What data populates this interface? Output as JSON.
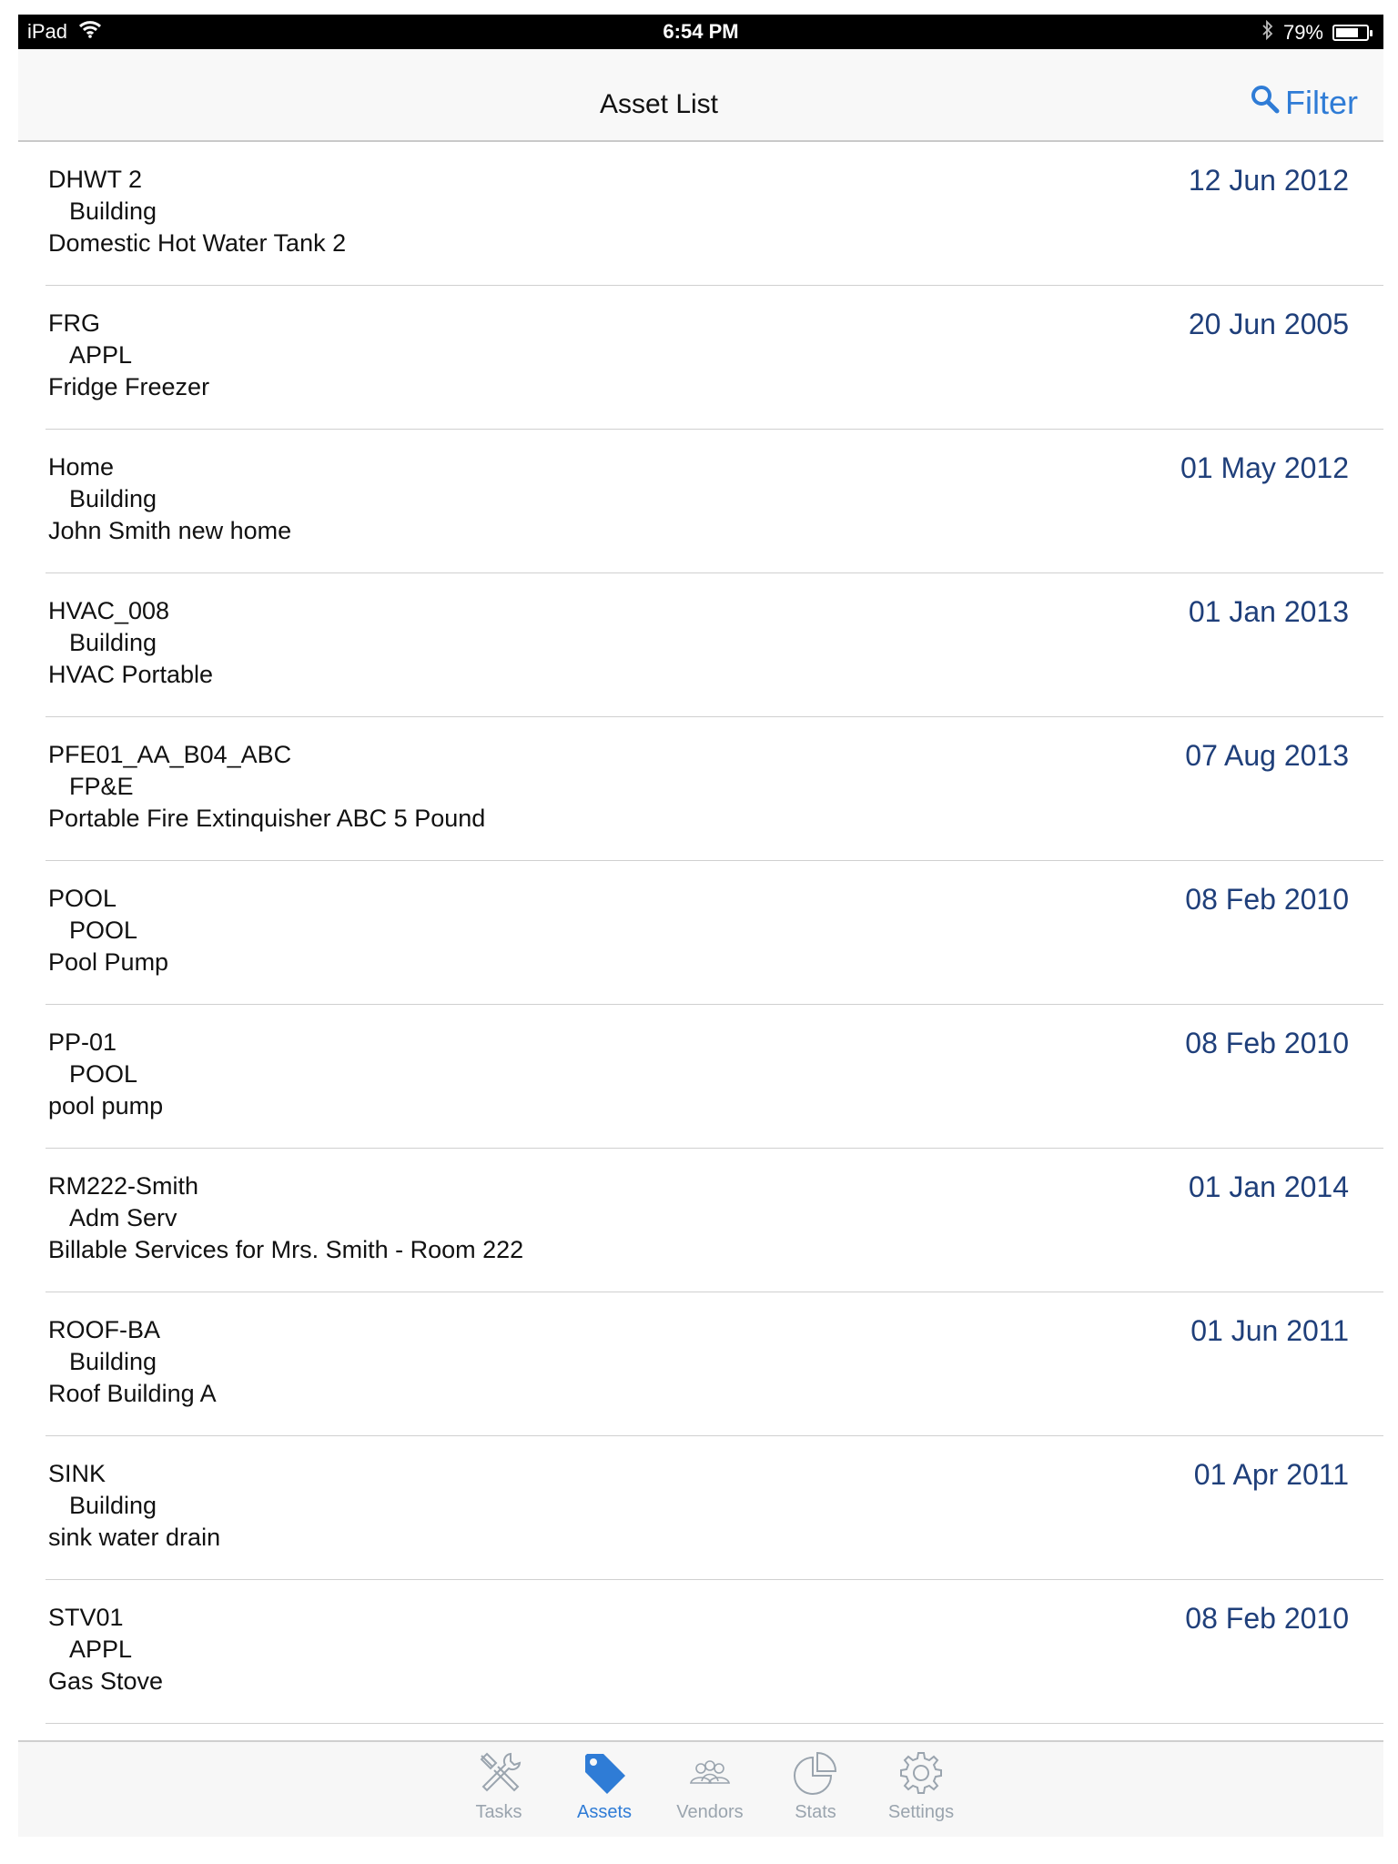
{
  "status_bar": {
    "device": "iPad",
    "time": "6:54 PM",
    "battery": "79%",
    "battery_level": 0.79
  },
  "nav": {
    "title": "Asset List",
    "filter_label": "Filter"
  },
  "assets": [
    {
      "code": "DHWT 2",
      "category": "Building",
      "description": "Domestic Hot Water Tank 2",
      "date": "12 Jun 2012"
    },
    {
      "code": "FRG",
      "category": "APPL",
      "description": "Fridge Freezer",
      "date": "20 Jun 2005"
    },
    {
      "code": "Home",
      "category": "Building",
      "description": "John Smith new home",
      "date": "01 May 2012"
    },
    {
      "code": "HVAC_008",
      "category": "Building",
      "description": "HVAC Portable",
      "date": "01 Jan 2013"
    },
    {
      "code": "PFE01_AA_B04_ABC",
      "category": "FP&E",
      "description": "Portable Fire Extinquisher ABC 5 Pound",
      "date": "07 Aug 2013"
    },
    {
      "code": "POOL",
      "category": "POOL",
      "description": "Pool Pump",
      "date": "08 Feb 2010"
    },
    {
      "code": "PP-01",
      "category": "POOL",
      "description": "pool pump",
      "date": "08 Feb 2010"
    },
    {
      "code": "RM222-Smith",
      "category": "Adm Serv",
      "description": "Billable Services for Mrs. Smith - Room 222",
      "date": "01 Jan 2014"
    },
    {
      "code": "ROOF-BA",
      "category": "Building",
      "description": "Roof Building A",
      "date": "01 Jun 2011"
    },
    {
      "code": "SINK",
      "category": "Building",
      "description": "sink water drain",
      "date": "01 Apr 2011"
    },
    {
      "code": "STV01",
      "category": "APPL",
      "description": "Gas Stove",
      "date": "08 Feb 2010"
    }
  ],
  "tabs": [
    {
      "label": "Tasks",
      "icon": "tools-icon",
      "active": false
    },
    {
      "label": "Assets",
      "icon": "tag-icon",
      "active": true
    },
    {
      "label": "Vendors",
      "icon": "people-icon",
      "active": false
    },
    {
      "label": "Stats",
      "icon": "pie-chart-icon",
      "active": false
    },
    {
      "label": "Settings",
      "icon": "gear-icon",
      "active": false
    }
  ],
  "colors": {
    "accent": "#2f7cd6",
    "date_text": "#1f3f7a",
    "tab_inactive": "#9aa4ae"
  }
}
